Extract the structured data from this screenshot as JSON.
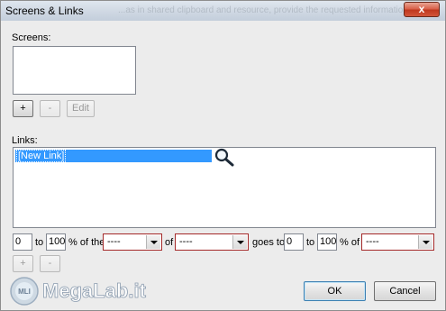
{
  "window": {
    "title": "Screens & Links",
    "ghost_text": "...as in shared clipboard and resource, provide the requested information.",
    "close_label": "x"
  },
  "screens": {
    "label": "Screens:",
    "add_label": "+",
    "remove_label": "-",
    "edit_label": "Edit"
  },
  "links": {
    "label": "Links:",
    "items": [
      "[New Link]"
    ],
    "add_label": "+",
    "remove_label": "-"
  },
  "mapping": {
    "from_value": "0",
    "to_text": "to",
    "to_value": "100",
    "pct_of_the": "% of the",
    "combo1_value": "----",
    "of_text": "of",
    "combo2_value": "----",
    "goes_to": "goes to",
    "dest_from_value": "0",
    "to_text2": "to",
    "dest_to_value": "100",
    "pct_of": "% of",
    "combo3_value": "----"
  },
  "buttons": {
    "ok": "OK",
    "cancel": "Cancel"
  },
  "watermark": {
    "text": "MegaLab.it",
    "badge": "MLI"
  },
  "colors": {
    "selection": "#3399ff",
    "accent_border": "#a52a2a"
  },
  "icons": [
    "magnifier-icon",
    "close-icon",
    "dropdown-arrow-icon"
  ]
}
